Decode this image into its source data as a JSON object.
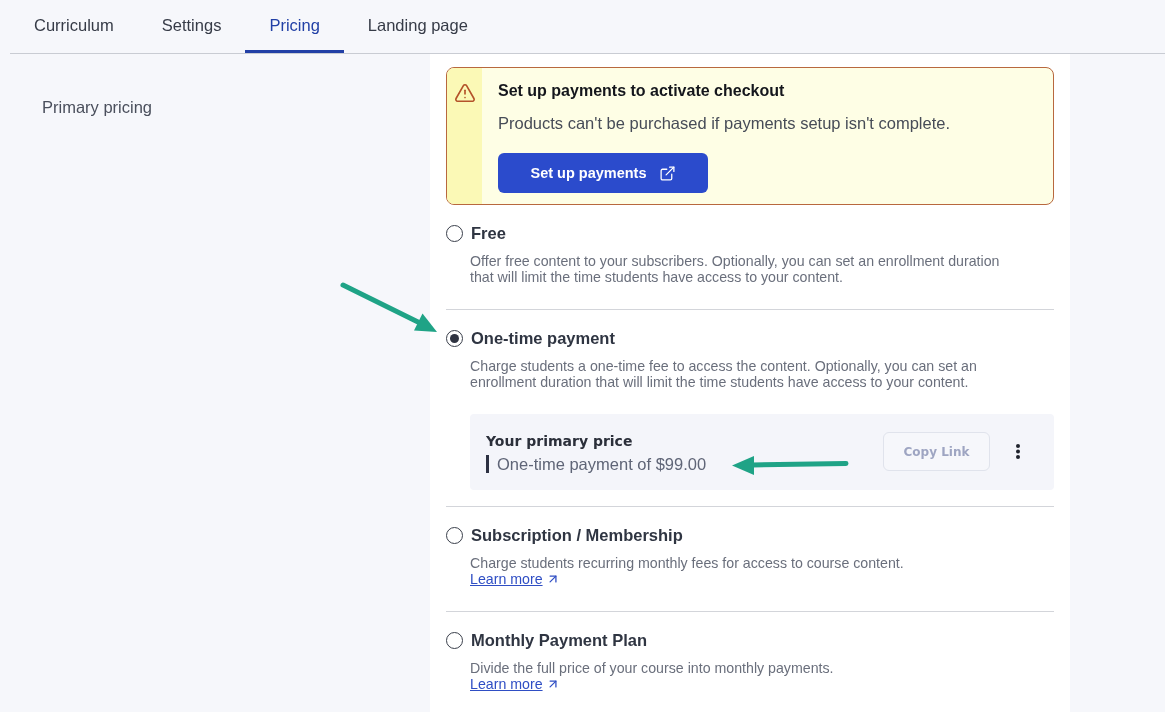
{
  "tabs": [
    {
      "label": "Curriculum",
      "selected": false
    },
    {
      "label": "Settings",
      "selected": false
    },
    {
      "label": "Pricing",
      "selected": true
    },
    {
      "label": "Landing page",
      "selected": false
    }
  ],
  "section_label": "Primary pricing",
  "alert": {
    "title": "Set up payments to activate checkout",
    "message": "Products can't be purchased if payments setup isn't complete.",
    "button": "Set up payments"
  },
  "pricing_options": [
    {
      "label": "Free",
      "selected": false,
      "description": "Offer free content to your subscribers. Optionally, you can set an enrollment duration that will limit the time students have access to your content."
    },
    {
      "label": "One-time payment",
      "selected": true,
      "description": "Charge students a one-time fee to access the content. Optionally, you can set an enrollment duration that will limit the time students have access to your content.",
      "primary_price": {
        "title": "Your primary price",
        "summary": "One-time payment of $99.00",
        "copy_button": {
          "label": "Copy Link",
          "disabled": true
        }
      }
    },
    {
      "label": "Subscription / Membership",
      "selected": false,
      "description": "Charge students recurring monthly fees for access to course content.",
      "link": "Learn more"
    },
    {
      "label": "Monthly Payment Plan",
      "selected": false,
      "description": "Divide the full price of your course into monthly payments.",
      "link": "Learn more"
    }
  ]
}
